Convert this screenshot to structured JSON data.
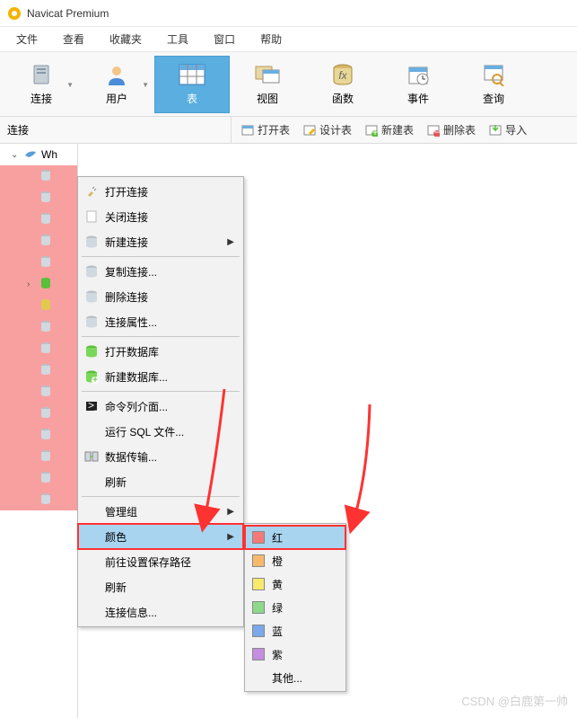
{
  "title": "Navicat Premium",
  "menubar": [
    "文件",
    "查看",
    "收藏夹",
    "工具",
    "窗口",
    "帮助"
  ],
  "toolbar": [
    {
      "label": "连接",
      "icon": "server",
      "dropdown": true
    },
    {
      "label": "用户",
      "icon": "user",
      "dropdown": true
    },
    {
      "label": "表",
      "icon": "table",
      "active": true
    },
    {
      "label": "视图",
      "icon": "view"
    },
    {
      "label": "函数",
      "icon": "function"
    },
    {
      "label": "事件",
      "icon": "event"
    },
    {
      "label": "查询",
      "icon": "query"
    }
  ],
  "subbar_left": "连接",
  "subbar_actions": [
    {
      "label": "打开表",
      "icon": "open"
    },
    {
      "label": "设计表",
      "icon": "design"
    },
    {
      "label": "新建表",
      "icon": "new"
    },
    {
      "label": "删除表",
      "icon": "delete"
    },
    {
      "label": "导入",
      "icon": "import"
    }
  ],
  "tree_root": "Wh",
  "context_menu": [
    {
      "label": "打开连接",
      "icon": "plug"
    },
    {
      "label": "关闭连接",
      "icon": "blank"
    },
    {
      "label": "新建连接",
      "icon": "db-new",
      "arrow": true,
      "sep_after": true
    },
    {
      "label": "复制连接...",
      "icon": "db-copy"
    },
    {
      "label": "删除连接",
      "icon": "db-del"
    },
    {
      "label": "连接属性...",
      "icon": "db-prop",
      "sep_after": true
    },
    {
      "label": "打开数据库",
      "icon": "db-open"
    },
    {
      "label": "新建数据库...",
      "icon": "db-add",
      "sep_after": true
    },
    {
      "label": "命令列介面...",
      "icon": "terminal"
    },
    {
      "label": "运行 SQL 文件..."
    },
    {
      "label": "数据传输...",
      "icon": "transfer"
    },
    {
      "label": "刷新",
      "sep_after": true
    },
    {
      "label": "管理组",
      "arrow": true
    },
    {
      "label": "颜色",
      "arrow": true,
      "hov": true,
      "highlight": true
    },
    {
      "label": "前往设置保存路径"
    },
    {
      "label": "刷新"
    },
    {
      "label": "连接信息..."
    }
  ],
  "color_submenu": [
    {
      "label": "红",
      "color": "#f47a7a",
      "hov": true,
      "highlight": true
    },
    {
      "label": "橙",
      "color": "#f7b96e"
    },
    {
      "label": "黄",
      "color": "#f7e96e"
    },
    {
      "label": "绿",
      "color": "#8ed98c"
    },
    {
      "label": "蓝",
      "color": "#7aa8e8"
    },
    {
      "label": "紫",
      "color": "#c58ee0"
    },
    {
      "label": "其他...",
      "color": null
    }
  ],
  "watermark": "CSDN @白鹿第一帅"
}
